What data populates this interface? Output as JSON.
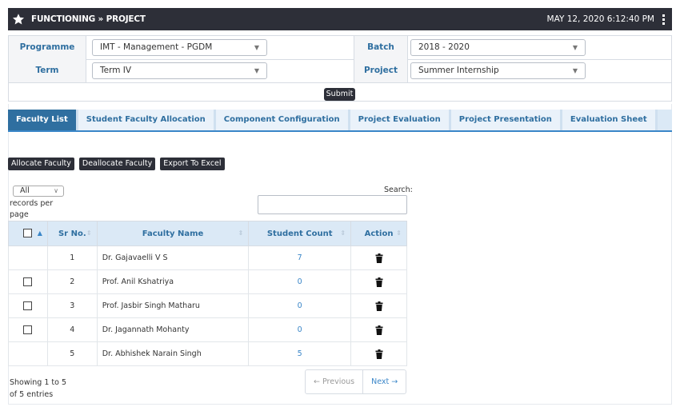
{
  "header": {
    "title": "FUNCTIONING » PROJECT",
    "datetime": "MAY 12, 2020  6:12:40 PM"
  },
  "filters": {
    "programme_label": "Programme",
    "programme_value": "IMT - Management - PGDM",
    "batch_label": "Batch",
    "batch_value": "2018 - 2020",
    "term_label": "Term",
    "term_value": "Term IV",
    "project_label": "Project",
    "project_value": "Summer Internship",
    "submit_label": "Submit"
  },
  "tabs": [
    {
      "label": "Faculty List",
      "active": true
    },
    {
      "label": "Student Faculty Allocation"
    },
    {
      "label": "Component Configuration"
    },
    {
      "label": "Project Evaluation"
    },
    {
      "label": "Project Presentation"
    },
    {
      "label": "Evaluation Sheet"
    }
  ],
  "actions": {
    "allocate": "Allocate Faculty",
    "deallocate": "Deallocate Faculty",
    "export": "Export To Excel"
  },
  "table_controls": {
    "length_value": "All",
    "records_per_page": "records per page",
    "search_label": "Search:"
  },
  "columns": [
    "Sr No.",
    "Faculty Name",
    "Student Count",
    "Action"
  ],
  "rows": [
    {
      "sr": "1",
      "name": "Dr. Gajavaelli V S",
      "count": "7",
      "checkbox": false
    },
    {
      "sr": "2",
      "name": "Prof. Anil Kshatriya",
      "count": "0",
      "checkbox": true
    },
    {
      "sr": "3",
      "name": "Prof. Jasbir Singh Matharu",
      "count": "0",
      "checkbox": true
    },
    {
      "sr": "4",
      "name": "Dr. Jagannath Mohanty",
      "count": "0",
      "checkbox": true
    },
    {
      "sr": "5",
      "name": "Dr. Abhishek Narain Singh",
      "count": "5",
      "checkbox": false
    }
  ],
  "footer": {
    "info": "Showing 1 to 5 of 5 entries",
    "previous": "← Previous",
    "next": "Next →"
  },
  "colors": {
    "header_bg": "#2d2f38",
    "accent": "#2f6fa0",
    "tab_bar": "#dbe9f6"
  },
  "icons": {
    "header": "star-icon",
    "menu": "kebab-menu-icon",
    "action": "trash-icon"
  }
}
